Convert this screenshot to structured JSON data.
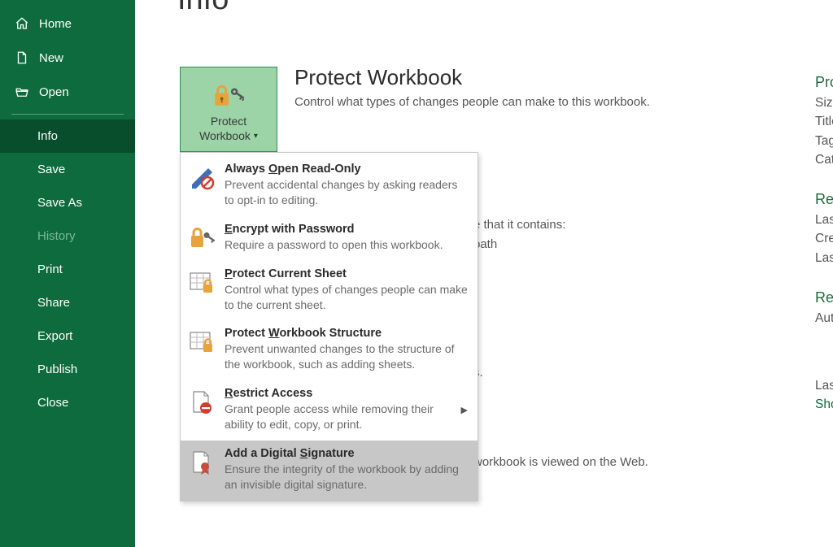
{
  "sidebar": {
    "items": [
      {
        "label": "Home",
        "icon": "home-icon"
      },
      {
        "label": "New",
        "icon": "new-file-icon"
      },
      {
        "label": "Open",
        "icon": "open-folder-icon"
      }
    ],
    "secondary": [
      {
        "label": "Info",
        "selected": true
      },
      {
        "label": "Save"
      },
      {
        "label": "Save As"
      },
      {
        "label": "History",
        "disabled": true
      },
      {
        "label": "Print"
      },
      {
        "label": "Share"
      },
      {
        "label": "Export"
      },
      {
        "label": "Publish"
      },
      {
        "label": "Close"
      }
    ]
  },
  "page": {
    "title": "Info"
  },
  "protect": {
    "button_line1": "Protect",
    "button_line2": "Workbook",
    "heading": "Protect Workbook",
    "description": "Control what types of changes people can make to this workbook."
  },
  "bg_text": {
    "a": "e that it contains:",
    "b": "path",
    "c": "s.",
    "d": "workbook is viewed on the Web."
  },
  "menu": {
    "items": [
      {
        "title_pre": "Always ",
        "title_u": "O",
        "title_post": "pen Read-Only",
        "desc": "Prevent accidental changes by asking readers to opt-in to editing.",
        "icon": "pencil-prohibit-icon"
      },
      {
        "title_pre": "",
        "title_u": "E",
        "title_post": "ncrypt with Password",
        "desc": "Require a password to open this workbook.",
        "icon": "lock-key-icon"
      },
      {
        "title_pre": "",
        "title_u": "P",
        "title_post": "rotect Current Sheet",
        "desc": "Control what types of changes people can make to the current sheet.",
        "icon": "sheet-lock-icon"
      },
      {
        "title_pre": "Protect ",
        "title_u": "W",
        "title_post": "orkbook Structure",
        "desc": "Prevent unwanted changes to the structure of the workbook, such as adding sheets.",
        "icon": "sheet-lock-icon"
      },
      {
        "title_pre": "",
        "title_u": "R",
        "title_post": "estrict Access",
        "desc": "Grant people access while removing their ability to edit, copy, or print.",
        "icon": "file-prohibit-icon",
        "submenu": true
      },
      {
        "title_pre": "Add a Digital ",
        "title_u": "S",
        "title_post": "ignature",
        "desc": "Ensure the integrity of the workbook by adding an invisible digital signature.",
        "icon": "file-ribbon-icon",
        "hover": true
      }
    ]
  },
  "properties": {
    "heading1": "Properties",
    "rows1": [
      "Size",
      "Title",
      "Tags",
      "Categories"
    ],
    "heading2": "Related Dates",
    "rows2": [
      "Last Modified",
      "Created",
      "Last Printed"
    ],
    "heading3": "Related People",
    "rows3": [
      "Author"
    ],
    "rows4": [
      "Last Modified By"
    ],
    "link": "Show All Properties"
  }
}
